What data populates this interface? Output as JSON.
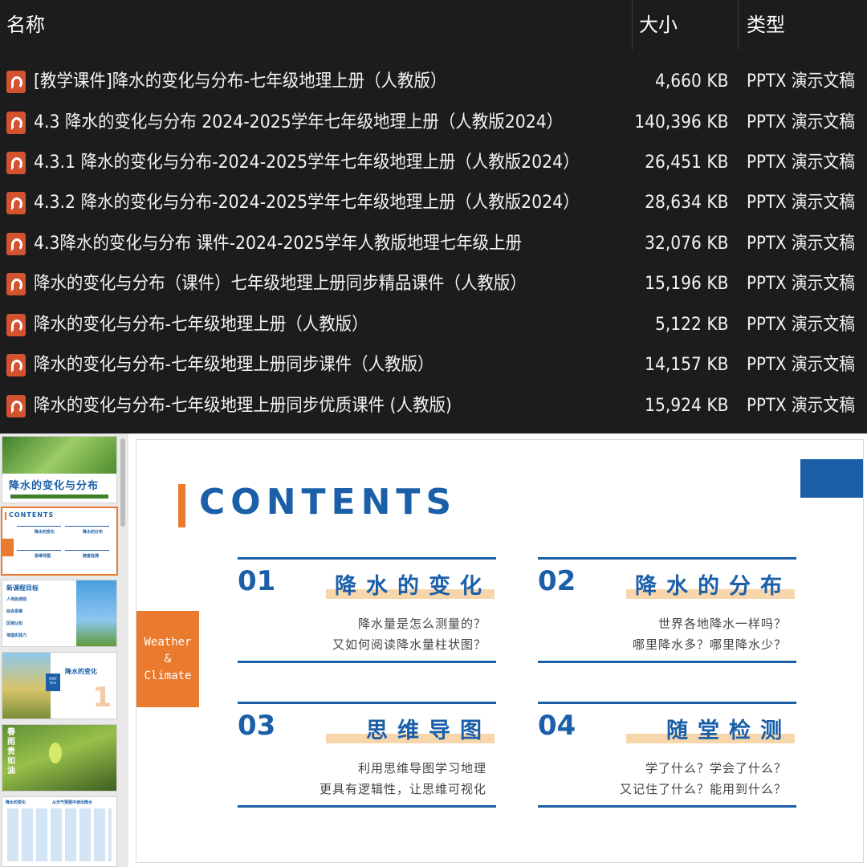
{
  "explorer": {
    "columns": {
      "name": "名称",
      "size": "大小",
      "type": "类型"
    },
    "files": [
      {
        "name": "[教学课件]降水的变化与分布-七年级地理上册（人教版）",
        "size": "4,660 KB",
        "type": "PPTX 演示文稿"
      },
      {
        "name": "4.3 降水的变化与分布 2024-2025学年七年级地理上册（人教版2024）",
        "size": "140,396 KB",
        "type": "PPTX 演示文稿"
      },
      {
        "name": "4.3.1 降水的变化与分布-2024-2025学年七年级地理上册（人教版2024）",
        "size": "26,451 KB",
        "type": "PPTX 演示文稿"
      },
      {
        "name": "4.3.2 降水的变化与分布-2024-2025学年七年级地理上册（人教版2024）",
        "size": "28,634 KB",
        "type": "PPTX 演示文稿"
      },
      {
        "name": "4.3降水的变化与分布 课件-2024-2025学年人教版地理七年级上册",
        "size": "32,076 KB",
        "type": "PPTX 演示文稿"
      },
      {
        "name": "降水的变化与分布（课件）七年级地理上册同步精品课件（人教版）",
        "size": "15,196 KB",
        "type": "PPTX 演示文稿"
      },
      {
        "name": "降水的变化与分布-七年级地理上册（人教版）",
        "size": "5,122 KB",
        "type": "PPTX 演示文稿"
      },
      {
        "name": "降水的变化与分布-七年级地理上册同步课件（人教版）",
        "size": "14,157 KB",
        "type": "PPTX 演示文稿"
      },
      {
        "name": "降水的变化与分布-七年级地理上册同步优质课件 (人教版)",
        "size": "15,924 KB",
        "type": "PPTX 演示文稿"
      }
    ]
  },
  "thumbnails": {
    "t1": {
      "title": "降水的变化与分布"
    },
    "t2": {
      "title": "CONTENTS",
      "items": [
        "降水的变化",
        "降水的分布",
        "思维导图",
        "随堂检测"
      ]
    },
    "t3": {
      "title": "新课程目标",
      "items": [
        "人地协调观",
        "综合思维",
        "区域认知",
        "地理实践力"
      ]
    },
    "t4": {
      "title": "降水的变化",
      "part": "PART One",
      "num": "1"
    },
    "t5": {
      "title": "春雨贵如油"
    },
    "t6": {
      "left": "降水的变化",
      "right": "从天气预报中读出降水"
    }
  },
  "slide": {
    "title": "CONTENTS",
    "side_label": [
      "Weather",
      "&",
      "Climate"
    ],
    "sections": [
      {
        "num": "01",
        "heading": "降水的变化",
        "lines": [
          "降水量是怎么测量的？",
          "又如何阅读降水量柱状图？"
        ]
      },
      {
        "num": "02",
        "heading": "降水的分布",
        "lines": [
          "世界各地降水一样吗？",
          "哪里降水多？哪里降水少？"
        ]
      },
      {
        "num": "03",
        "heading": "思维导图",
        "lines": [
          "利用思维导图学习地理",
          "更具有逻辑性，让思维可视化"
        ]
      },
      {
        "num": "04",
        "heading": "随堂检测",
        "lines": [
          "学了什么？学会了什么？",
          "又记住了什么？能用到什么？"
        ]
      }
    ]
  },
  "colors": {
    "explorer_bg": "#1c1c1c",
    "ppt_icon": "#d35230",
    "accent_blue": "#1a5fa8",
    "accent_orange": "#ea7a2e"
  }
}
